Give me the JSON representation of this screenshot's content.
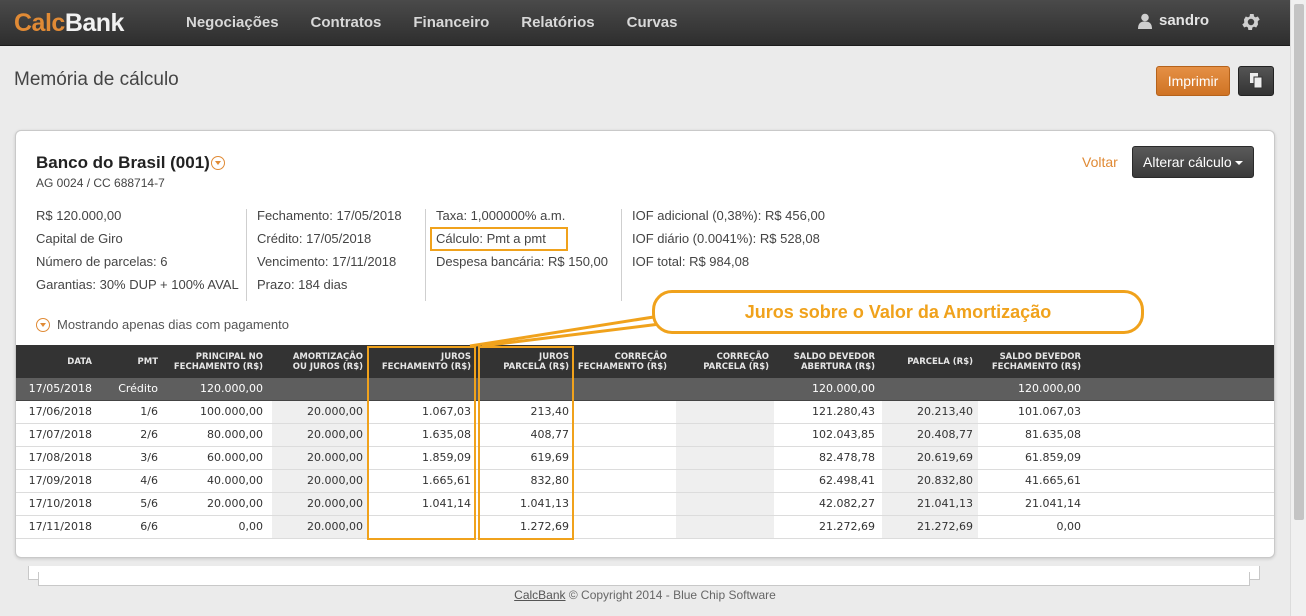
{
  "app": {
    "logo_part1": "Calc",
    "logo_part2": "Bank"
  },
  "nav": [
    "Negociações",
    "Contratos",
    "Financeiro",
    "Relatórios",
    "Curvas"
  ],
  "user": {
    "name": "sandro"
  },
  "page": {
    "title": "Memória de cálculo",
    "print_label": "Imprimir"
  },
  "card": {
    "bank_name": "Banco do Brasil (001)",
    "account": "AG 0024 / CC 688714-7",
    "back_label": "Voltar",
    "alter_label": "Alterar cálculo",
    "info": {
      "col1": [
        "R$ 120.000,00",
        "Capital de Giro",
        "Número de parcelas: 6",
        "Garantias: 30% DUP + 100% AVAL"
      ],
      "col2": [
        "Fechamento: 17/05/2018",
        "Crédito: 17/05/2018",
        "Vencimento: 17/11/2018",
        "Prazo: 184 dias"
      ],
      "col3": [
        "Taxa: 1,000000% a.m.",
        "Cálculo: Pmt a pmt",
        "Despesa bancária: R$ 150,00"
      ],
      "col4": [
        "IOF adicional (0,38%): R$ 456,00",
        "IOF diário (0.0041%): R$ 528,08",
        "IOF total: R$ 984,08"
      ]
    },
    "filter_label": "Mostrando apenas dias com pagamento"
  },
  "table": {
    "headers": [
      [
        "DATA",
        ""
      ],
      [
        "PMT",
        ""
      ],
      [
        "PRINCIPAL NO",
        "FECHAMENTO (R$)"
      ],
      [
        "AMORTIZAÇÃO",
        "OU JUROS (R$)"
      ],
      [
        "JUROS",
        "FECHAMENTO (R$)"
      ],
      [
        "JUROS",
        "PARCELA (R$)"
      ],
      [
        "CORREÇÃO",
        "FECHAMENTO (R$)"
      ],
      [
        "CORREÇÃO",
        "PARCELA (R$)"
      ],
      [
        "SALDO DEVEDOR",
        "ABERTURA (R$)"
      ],
      [
        "PARCELA (R$)",
        ""
      ],
      [
        "SALDO DEVEDOR",
        "FECHAMENTO (R$)"
      ]
    ],
    "rows": [
      [
        "17/05/2018",
        "Crédito",
        "120.000,00",
        "",
        "",
        "",
        "",
        "",
        "120.000,00",
        "",
        "120.000,00"
      ],
      [
        "17/06/2018",
        "1/6",
        "100.000,00",
        "20.000,00",
        "1.067,03",
        "213,40",
        "",
        "",
        "121.280,43",
        "20.213,40",
        "101.067,03"
      ],
      [
        "17/07/2018",
        "2/6",
        "80.000,00",
        "20.000,00",
        "1.635,08",
        "408,77",
        "",
        "",
        "102.043,85",
        "20.408,77",
        "81.635,08"
      ],
      [
        "17/08/2018",
        "3/6",
        "60.000,00",
        "20.000,00",
        "1.859,09",
        "619,69",
        "",
        "",
        "82.478,78",
        "20.619,69",
        "61.859,09"
      ],
      [
        "17/09/2018",
        "4/6",
        "40.000,00",
        "20.000,00",
        "1.665,61",
        "832,80",
        "",
        "",
        "62.498,41",
        "20.832,80",
        "41.665,61"
      ],
      [
        "17/10/2018",
        "5/6",
        "20.000,00",
        "20.000,00",
        "1.041,14",
        "1.041,13",
        "",
        "",
        "42.082,27",
        "21.041,13",
        "21.041,14"
      ],
      [
        "17/11/2018",
        "6/6",
        "0,00",
        "20.000,00",
        "",
        "1.272,69",
        "",
        "",
        "21.272,69",
        "21.272,69",
        "0,00"
      ]
    ]
  },
  "annotation": {
    "text": "Juros sobre o Valor da Amortização"
  },
  "footer": {
    "link": "CalcBank",
    "text": " © Copyright 2014 - Blue Chip Software"
  },
  "colors": {
    "accent": "#e08a35",
    "highlight": "#f0a21c",
    "topbar": "#3a3a3a"
  }
}
